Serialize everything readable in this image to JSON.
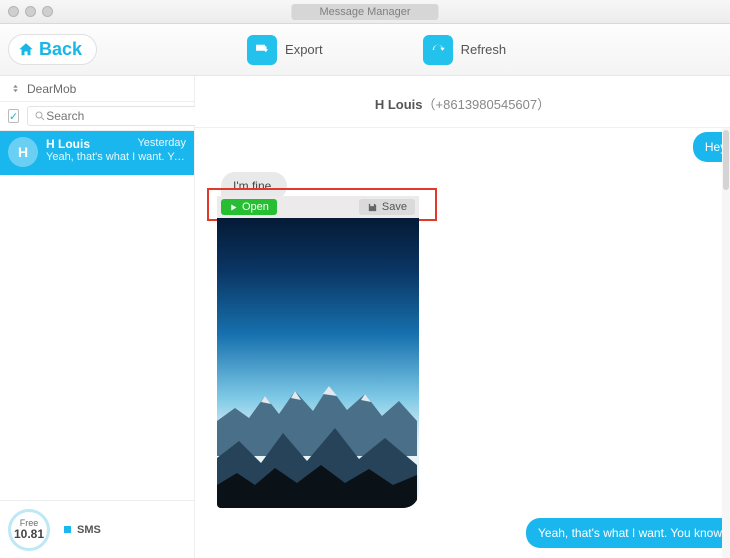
{
  "window": {
    "title": "Message Manager"
  },
  "toolbar": {
    "back": "Back",
    "export": "Export",
    "refresh": "Refresh"
  },
  "sidebar": {
    "brand": "DearMob",
    "search_placeholder": "Search",
    "conversations": [
      {
        "initial": "H",
        "name": "H Louis",
        "time": "Yesterday",
        "preview": "Yeah, that's what I want. You kno..."
      }
    ],
    "storage": {
      "label": "Free",
      "amount": "10.81"
    },
    "category": "SMS"
  },
  "chat": {
    "header_name": "H Louis",
    "header_phone": "（+8613980545607）",
    "messages": {
      "out1": "Hey, how",
      "in1": "I'm fine.",
      "out2": "Yeah, that's what I want. You know me so"
    },
    "image_actions": {
      "open": "Open",
      "save": "Save"
    }
  }
}
